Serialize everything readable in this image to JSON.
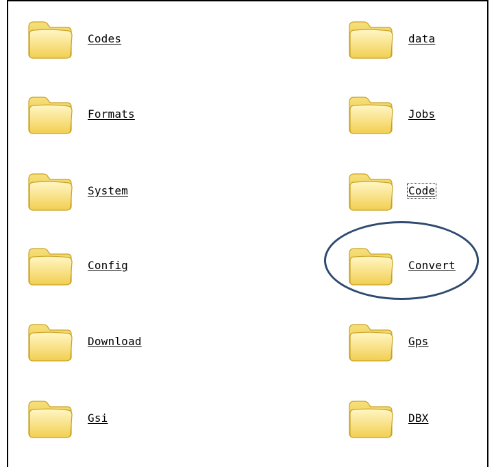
{
  "folders": [
    {
      "label": "Codes"
    },
    {
      "label": "Formats"
    },
    {
      "label": "System"
    },
    {
      "label": "Config"
    },
    {
      "label": "Download"
    },
    {
      "label": "Gsi"
    },
    {
      "label": "data"
    },
    {
      "label": "Jobs"
    },
    {
      "label": "Code"
    },
    {
      "label": "Convert"
    },
    {
      "label": "Gps"
    },
    {
      "label": "DBX"
    }
  ],
  "focused_folder": "Code",
  "highlighted_folder": "Convert",
  "colors": {
    "folder_fill": "#fde98a",
    "folder_edge": "#c8a226",
    "highlight_ring": "#2e4a70"
  },
  "icon": "folder-icon"
}
